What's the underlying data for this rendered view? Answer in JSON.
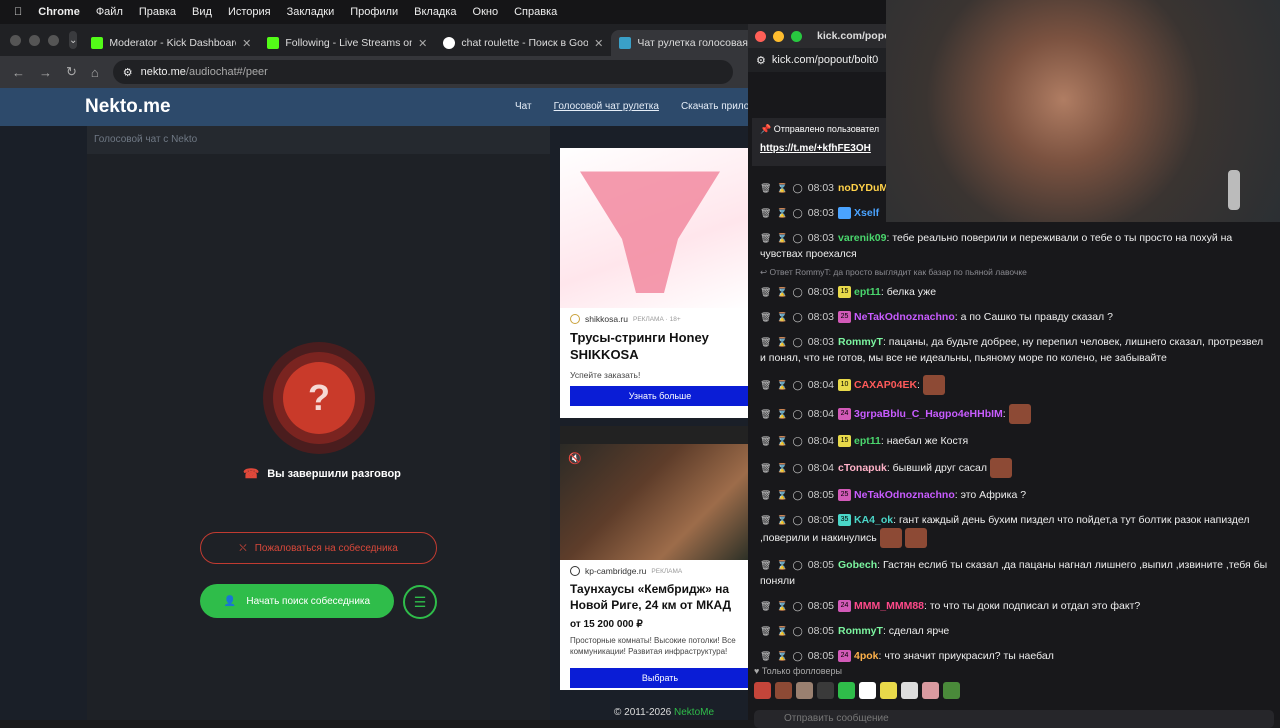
{
  "menubar": {
    "apple": "",
    "app": "Chrome",
    "items": [
      "Файл",
      "Правка",
      "Вид",
      "История",
      "Закладки",
      "Профили",
      "Вкладка",
      "Окно",
      "Справка"
    ]
  },
  "tabs": [
    {
      "title": "Moderator - Kick Dashboard",
      "color": "#53fc18"
    },
    {
      "title": "Following - Live Streams on K",
      "color": "#53fc18"
    },
    {
      "title": "chat roulette - Поиск в Goog",
      "color": "#4285f4"
    },
    {
      "title": "Чат рулетка голосовая",
      "color": "#3aa0c8"
    }
  ],
  "address": {
    "host": "nekto.me",
    "path": "/audiochat#/peer"
  },
  "site": {
    "logo": "Nekto.me",
    "nav": [
      "Чат",
      "Голосовой чат рулетка",
      "Скачать прилож"
    ],
    "panel_title": "Голосовой чат с Nekto",
    "question": "?",
    "ended": "Вы завершили разговор",
    "report": "Пожаловаться на собеседника",
    "start": "Начать поиск собеседника",
    "copyright": "© 2011-2026 ",
    "copyright_link": "NektoMe"
  },
  "ad1": {
    "source": "shikkosa.ru",
    "tag": "РЕКЛАМА · 18+",
    "title": "Трусы-стринги Honey SHIKKOSA",
    "subtitle": "Успейте заказать!",
    "button": "Узнать больше"
  },
  "ad2": {
    "source": "kp-cambridge.ru",
    "tag": "РЕКЛАМА",
    "title": "Таунхаусы «Кембридж» на Новой Риге, 24 км от МКАД",
    "price": "от 15 200 000 ₽",
    "desc": "Просторные комнаты! Высокие потолки! Все коммуникации! Развитая инфраструктура!",
    "button": "Выбрать"
  },
  "chat": {
    "window_url": "kick.com/popout",
    "url": "kick.com/popout/bolt0",
    "pinned_by": "Отправлено пользовател",
    "pinned_link": "https://t.me/+kfhFE3OH",
    "reply_note": "Ответ RommyT: да просто выглядит как базар по пьяной лавочке",
    "messages": [
      {
        "time": "08:03",
        "user": "noDYDuM",
        "color": "#ffd24a",
        "badge": "",
        "text": ""
      },
      {
        "time": "08:03",
        "user": "Xself",
        "color": "#4aa3ff",
        "badge": "",
        "text": ""
      },
      {
        "time": "08:03",
        "user": "varenik09",
        "color": "#4ad66d",
        "badge": "",
        "text": ": тебе реально поверили и переживали о тебе о ты просто на похуй на чувствах проехался"
      },
      {
        "time": "08:03",
        "user": "ept11",
        "color": "#4ad66d",
        "badge": "15",
        "text": ": белка уже"
      },
      {
        "time": "08:03",
        "user": "NeTakOdnoznachno",
        "color": "#c85cff",
        "badge": "25",
        "text": ": а по Сашко ты правду сказал ?"
      },
      {
        "time": "08:03",
        "user": "RommyT",
        "color": "#7cf5a0",
        "badge": "",
        "text": ": пацаны, да будьте добрее, ну перепил человек, лишнего сказал, протрезвел и понял, что не готов, мы все не идеальны, пьяному море по колено, не забывайте"
      },
      {
        "time": "08:04",
        "user": "CAXAP04EK",
        "color": "#ff5a5a",
        "badge": "10",
        "text": ":"
      },
      {
        "time": "08:04",
        "user": "3grpaBblu_C_Hagpo4eHHbIM",
        "color": "#c85cff",
        "badge": "24",
        "text": ":"
      },
      {
        "time": "08:04",
        "user": "ept11",
        "color": "#4ad66d",
        "badge": "15",
        "text": ": наебал же Костя"
      },
      {
        "time": "08:04",
        "user": "cTonapuk",
        "color": "#ffb2c8",
        "badge": "",
        "text": ": бывший друг сасал"
      },
      {
        "time": "08:05",
        "user": "NeTakOdnoznachno",
        "color": "#c85cff",
        "badge": "25",
        "text": ": это Африка ?"
      },
      {
        "time": "08:05",
        "user": "KA4_ok",
        "color": "#4ad6c8",
        "badge": "35",
        "text": ": гант каждый день бухим пиздел что пойдет,а тут болтик разок напиздел ,поверили и накинулись"
      },
      {
        "time": "08:05",
        "user": "Gobech",
        "color": "#7cf5a0",
        "badge": "",
        "text": ": Гастян еслиб ты сказал ,да пацаны нагнал лишнего ,выпил ,извините ,тебя бы поняли"
      },
      {
        "time": "08:05",
        "user": "MMM_MMM88",
        "color": "#ff4a8a",
        "badge": "24",
        "text": ": то что ты доки подписал и отдал это факт?"
      },
      {
        "time": "08:05",
        "user": "RommyT",
        "color": "#7cf5a0",
        "badge": "",
        "text": ": сделал ярче"
      },
      {
        "time": "08:05",
        "user": "4pok",
        "color": "#ffb24a",
        "badge": "24",
        "text": ": что значит приукрасил? ты наебал"
      }
    ],
    "followers_only": "Только фолловеры",
    "input_placeholder": "Отправить сообщение"
  }
}
